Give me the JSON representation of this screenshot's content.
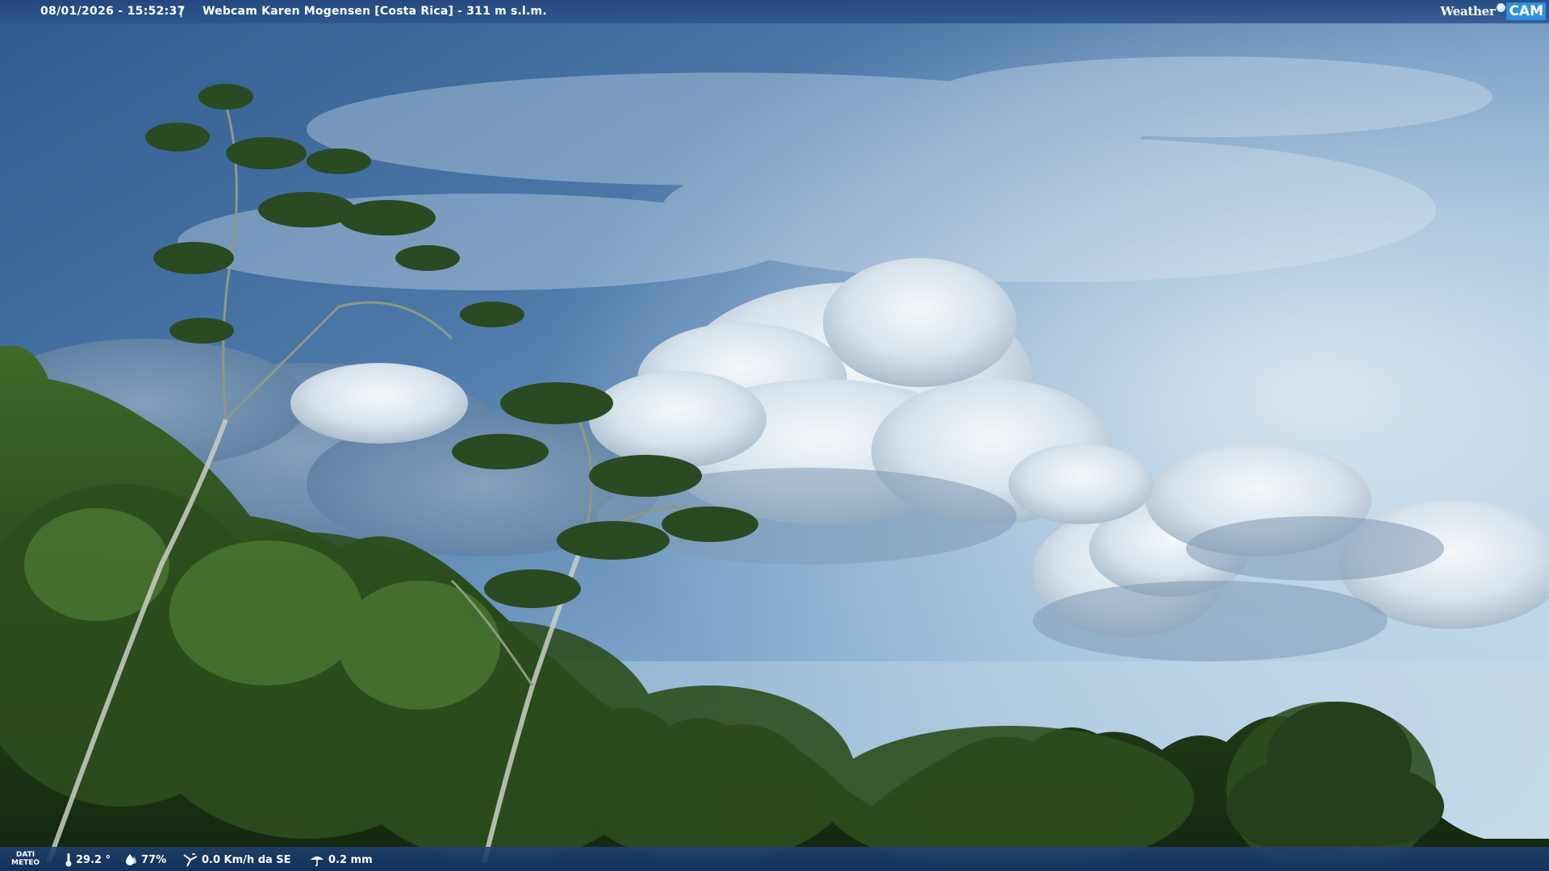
{
  "header": {
    "datetime": "08/01/2026 - 15:52:37",
    "separator": "|",
    "title": "Webcam Karen Mogensen [Costa Rica]  - 311 m s.l.m."
  },
  "logo": {
    "text_weather": "Weather",
    "text_cam": "CAM"
  },
  "footer": {
    "data_label_line1": "DATI",
    "data_label_line2": "METEO",
    "temperature": "29.2 °",
    "humidity": "77%",
    "wind": "0.0 Km/h da SE",
    "rain": "0.2 mm"
  },
  "icons": {
    "temperature": "thermometer-icon",
    "humidity": "humidity-drop-icon",
    "wind": "wind-icon",
    "rain": "rain-icon"
  },
  "colors": {
    "bar_background": "#23467d",
    "logo_accent": "#2d8fe0",
    "text": "#ffffff"
  }
}
